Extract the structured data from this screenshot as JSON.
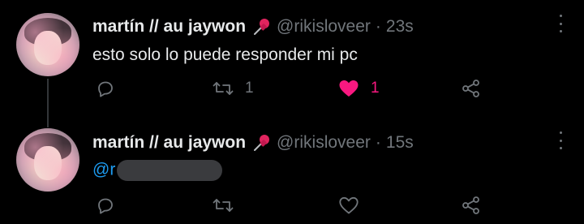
{
  "tweets": [
    {
      "display_name": "martín // au jaywon",
      "pin_emoji": "pushpin-icon",
      "handle": "@rikisloveer",
      "separator": "·",
      "time": "23s",
      "text": "esto solo lo puede responder mi pc",
      "reply_count": "",
      "retweet_count": "1",
      "like_count": "1",
      "liked": true
    },
    {
      "display_name": "martín // au jaywon",
      "pin_emoji": "pushpin-icon",
      "handle": "@rikisloveer",
      "separator": "·",
      "time": "15s",
      "mention_visible": "@r",
      "mention_redacted": true,
      "reply_count": "",
      "retweet_count": "",
      "like_count": "",
      "liked": false
    }
  ],
  "colors": {
    "background": "#000000",
    "text_primary": "#e7e9ea",
    "text_secondary": "#71767b",
    "link": "#1d9bf0",
    "like_active": "#f91880",
    "pin_red": "#e0245e"
  },
  "icons": [
    "reply-icon",
    "retweet-icon",
    "heart-icon",
    "share-icon",
    "more-icon",
    "pushpin-icon"
  ]
}
